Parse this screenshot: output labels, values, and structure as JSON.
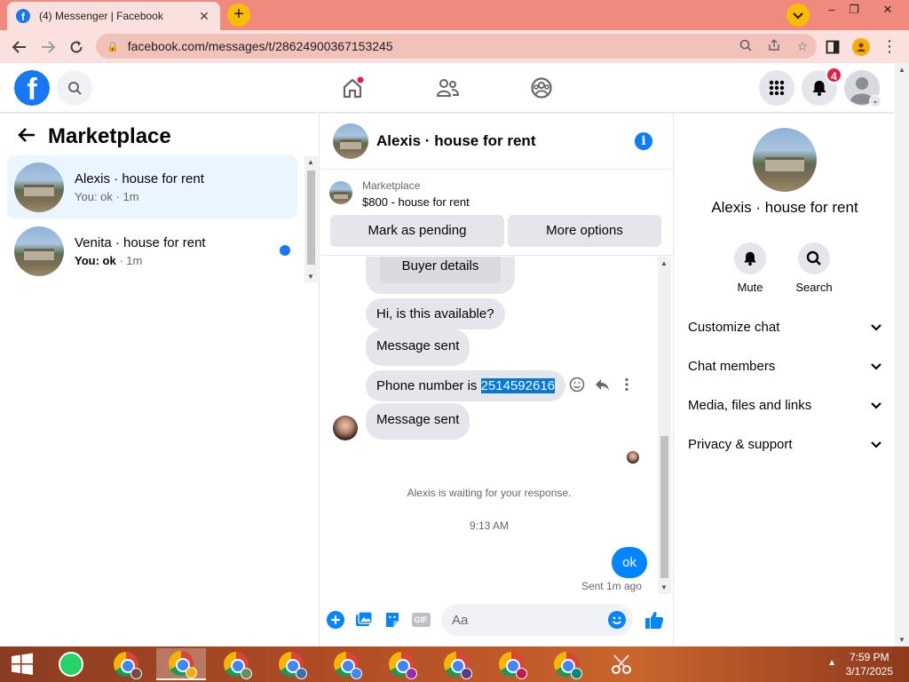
{
  "browser": {
    "tab_title": "(4) Messenger | Facebook",
    "url": "facebook.com/messages/t/28624900367153245",
    "window_controls": [
      "–",
      "❐",
      "✕"
    ]
  },
  "fb_nav": {
    "notification_count": "4"
  },
  "left": {
    "title": "Marketplace",
    "conversations": [
      {
        "name": "Alexis · house for rent",
        "preview_prefix": "You: ok",
        "preview_time": " · 1m",
        "active": true
      },
      {
        "name": "Venita · house for rent",
        "preview_prefix": "You: ok",
        "preview_time": " · 1m",
        "unread": true
      }
    ]
  },
  "chat": {
    "title": "Alexis · house for rent",
    "marketplace_label": "Marketplace",
    "listing": "$800 - house for rent",
    "btn_pending": "Mark as pending",
    "btn_more": "More options",
    "buyer_details": "Buyer details",
    "messages": {
      "m1": "Hi, is this available?",
      "m2": "Message sent",
      "m3_prefix": "Phone number is ",
      "m3_number": "2514592616",
      "m4": "Message sent"
    },
    "waiting": "Alexis is waiting for your response.",
    "time": "9:13 AM",
    "outgoing": "ok",
    "sent_status": "Sent 1m ago",
    "composer_placeholder": "Aa"
  },
  "right": {
    "name": "Alexis · house for rent",
    "mute": "Mute",
    "search": "Search",
    "rows": [
      "Customize chat",
      "Chat members",
      "Media, files and links",
      "Privacy & support"
    ]
  },
  "taskbar": {
    "time": "7:59 PM",
    "date": "3/17/2025"
  },
  "colors": {
    "fb_blue": "#1877f2",
    "messenger_blue": "#0084ff",
    "tab_strip": "#f08a7e",
    "toolbar": "#fbe1de"
  }
}
